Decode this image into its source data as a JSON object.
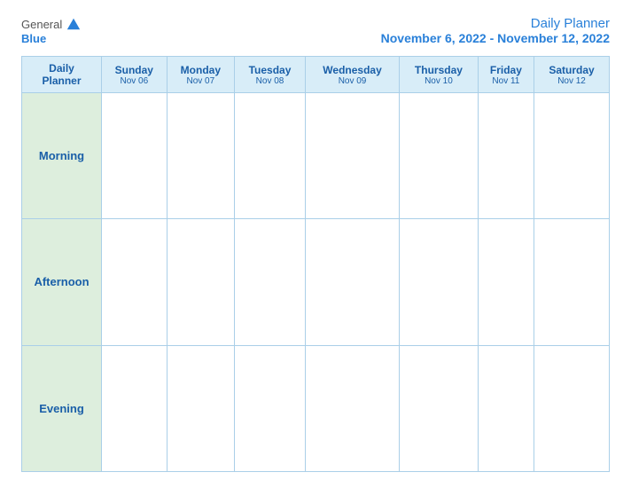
{
  "header": {
    "logo": {
      "general": "General",
      "blue": "Blue",
      "icon_unicode": "▶"
    },
    "title": "Daily Planner",
    "date_range": "November 6, 2022 - November 12, 2022"
  },
  "table": {
    "header_label": "Daily\nPlanner",
    "days": [
      {
        "name": "Sunday",
        "date": "Nov 06"
      },
      {
        "name": "Monday",
        "date": "Nov 07"
      },
      {
        "name": "Tuesday",
        "date": "Nov 08"
      },
      {
        "name": "Wednesday",
        "date": "Nov 09"
      },
      {
        "name": "Thursday",
        "date": "Nov 10"
      },
      {
        "name": "Friday",
        "date": "Nov 11"
      },
      {
        "name": "Saturday",
        "date": "Nov 12"
      }
    ],
    "rows": [
      {
        "label": "Morning"
      },
      {
        "label": "Afternoon"
      },
      {
        "label": "Evening"
      }
    ]
  }
}
